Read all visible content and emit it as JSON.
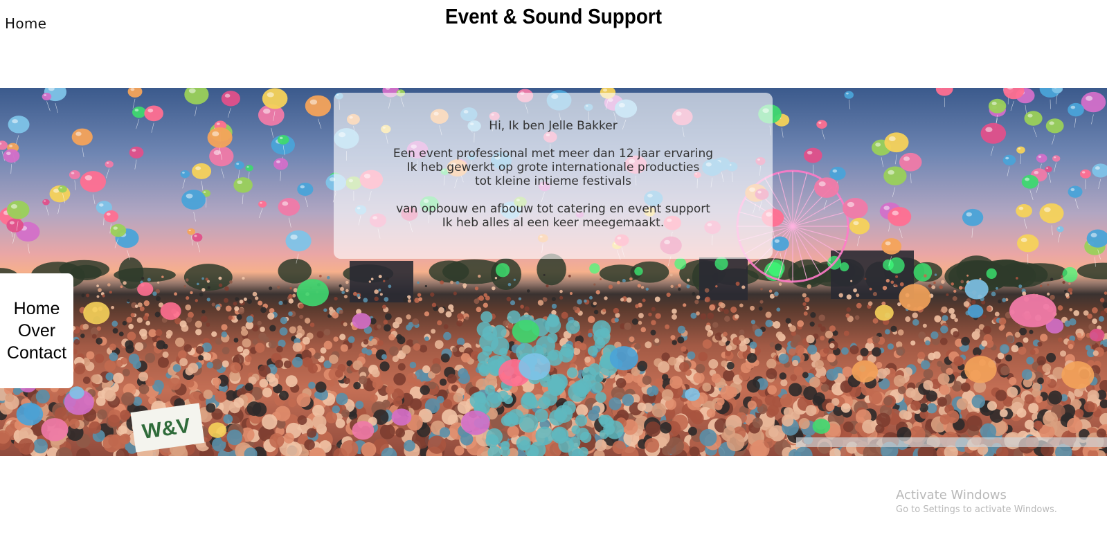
{
  "header": {
    "home_link": "Home",
    "title": "Event & Sound Support"
  },
  "intro": {
    "greeting": "Hi, Ik ben Jelle Bakker",
    "paragraph1": [
      "Een event professional met meer dan 12 jaar ervaring",
      "Ik heb gewerkt op grote internationale producties",
      "tot kleine intieme festivals"
    ],
    "paragraph2": [
      "van opbouw en afbouw tot catering en event support",
      "Ik heb alles al een keer meegemaakt."
    ]
  },
  "side_nav": {
    "items": [
      "Home",
      "Over",
      "Contact"
    ]
  },
  "hero": {
    "image": "festival-crowd-balloons-image",
    "banner_text": "W&V"
  },
  "watermark": {
    "title": "Activate Windows",
    "subtitle": "Go to Settings to activate Windows."
  },
  "colors": {
    "balloons": [
      "#e0508a",
      "#f07aa8",
      "#4aa3d8",
      "#f4a35a",
      "#9ad05a",
      "#d36fc9",
      "#7ec3e8",
      "#f6d25a",
      "#ff6f91",
      "#3fd870"
    ],
    "crowd": [
      "#c26a50",
      "#a8543f",
      "#e08d6d",
      "#7c3d30",
      "#d9a07f",
      "#5a8fa8",
      "#f1c3a5",
      "#2e2a2a",
      "#8f5a48",
      "#e7b597"
    ]
  }
}
